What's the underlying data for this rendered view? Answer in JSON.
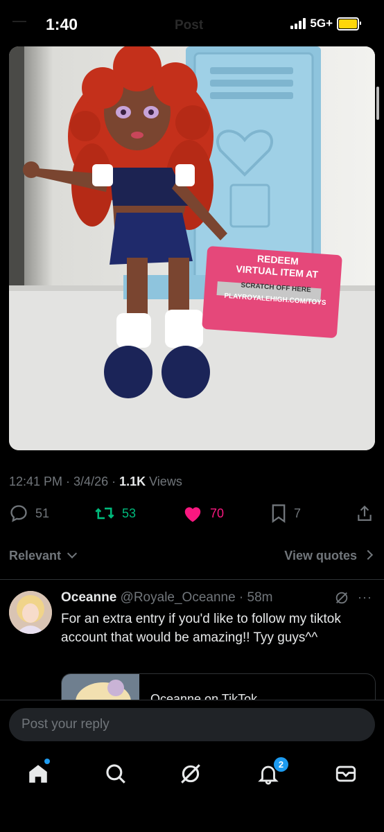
{
  "status": {
    "time": "1:40",
    "network": "5G+"
  },
  "header": {
    "title": "Post"
  },
  "photo": {
    "card_lines": [
      "REDEEM",
      "VIRTUAL ITEM AT",
      "SCRATCH OFF HERE",
      "PLAYROYALEHIGH.COM/TOYS"
    ]
  },
  "post": {
    "timestamp": "12:41 PM · 3/4/26 · ",
    "views_count": "1.1K",
    "views_label": " Views",
    "replies": "51",
    "reposts": "53",
    "likes": "70",
    "bookmarks": "7"
  },
  "sort": {
    "label": "Relevant",
    "view_quotes": "View quotes"
  },
  "reply": {
    "name": "Oceanne",
    "handle": "@Royale_Oceanne · 58m",
    "text": "For an extra entry if you'd like to follow my tiktok account that would be amazing!! Tyy guys^^",
    "embed_title": "Oceanne on TikTok"
  },
  "composer": {
    "placeholder": "Post your reply"
  },
  "nav": {
    "notifications_badge": "2"
  },
  "colors": {
    "accent": "#1d9bf0",
    "like": "#f91880",
    "repost": "#00ba7c",
    "muted": "#71767b"
  }
}
